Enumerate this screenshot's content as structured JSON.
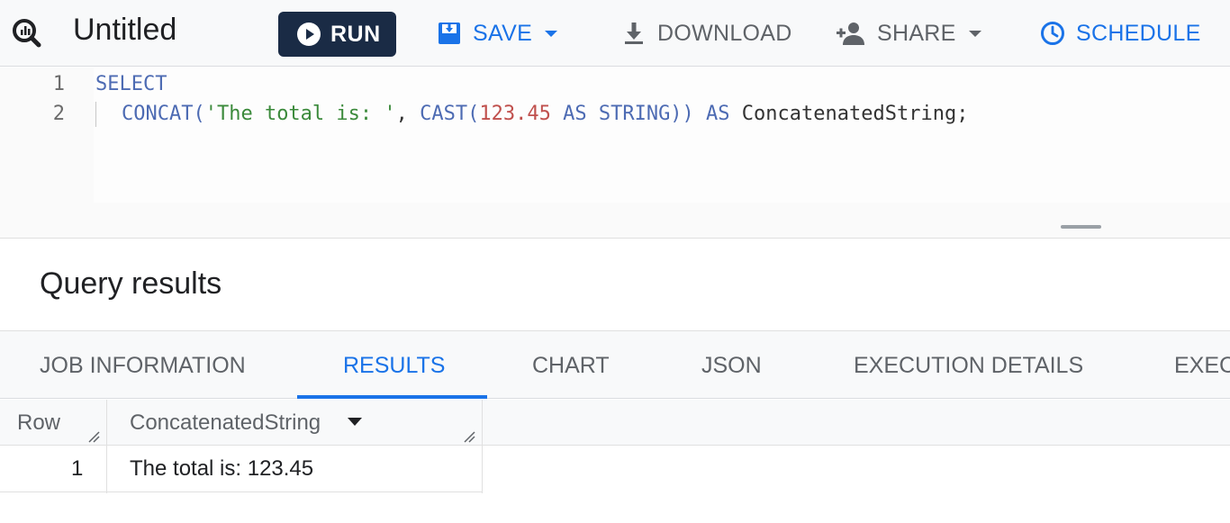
{
  "toolbar": {
    "title": "Untitled",
    "run_label": "RUN",
    "save_label": "SAVE",
    "download_label": "DOWNLOAD",
    "share_label": "SHARE",
    "schedule_label": "SCHEDULE"
  },
  "editor": {
    "line_numbers": [
      "1",
      "2"
    ],
    "line1": "SELECT",
    "line2": {
      "t1": "CONCAT(",
      "t2": "'The total is: '",
      "t3": ", ",
      "t4": "CAST(",
      "t5": "123.45",
      "t6": " AS STRING)) AS ",
      "t7": "ConcatenatedString;"
    }
  },
  "results": {
    "title": "Query results",
    "tabs": [
      "JOB INFORMATION",
      "RESULTS",
      "CHART",
      "JSON",
      "EXECUTION DETAILS",
      "EXEC"
    ],
    "active_tab": "RESULTS",
    "columns": [
      "Row",
      "ConcatenatedString"
    ],
    "rows": [
      {
        "row": "1",
        "value": "The total is: 123.45"
      }
    ]
  },
  "colors": {
    "accent": "#1a73e8",
    "run_button": "#1a2b45"
  },
  "icons": [
    "bigquery-logo-icon",
    "play-icon",
    "save-icon",
    "download-icon",
    "share-person-icon",
    "clock-icon",
    "resize-grip-icon"
  ]
}
